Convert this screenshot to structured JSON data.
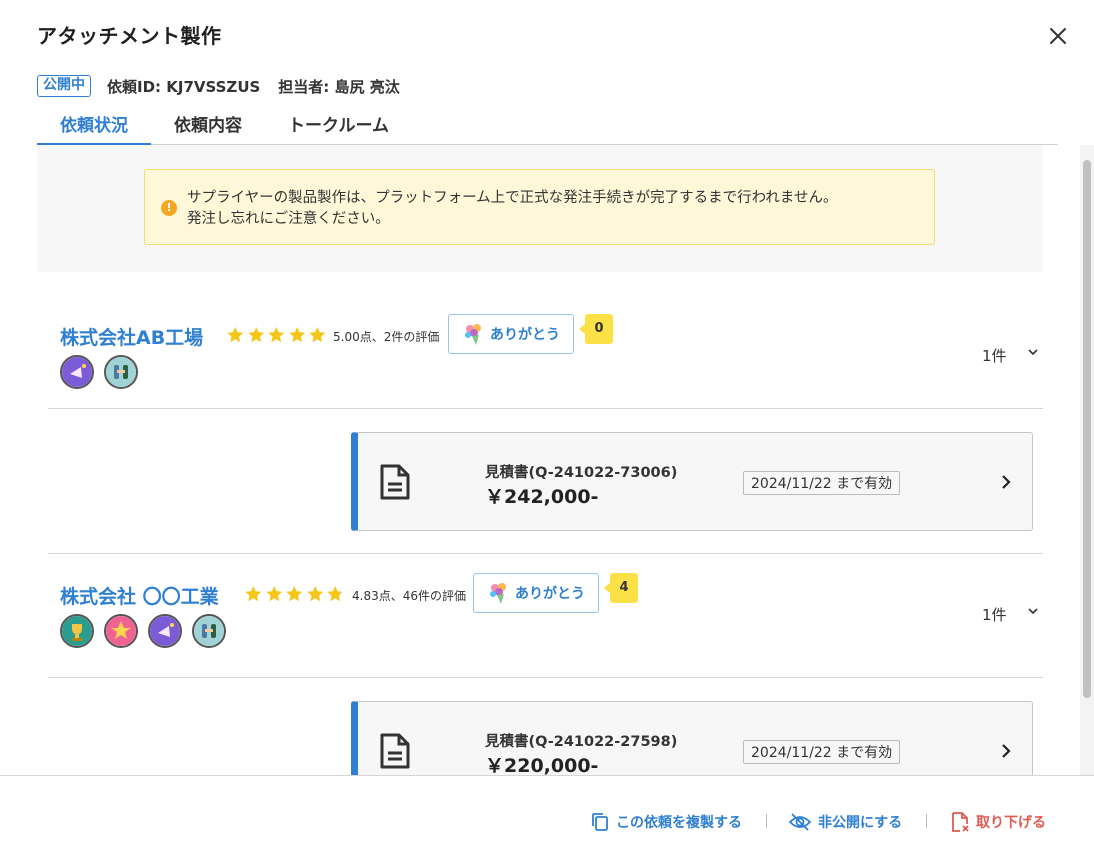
{
  "dialog": {
    "title": "アタッチメント製作"
  },
  "meta": {
    "status_badge": "公開中",
    "request_id": "依頼ID: KJ7VSSZUS",
    "assignee": "担当者: 島尻 亮汰"
  },
  "tabs": [
    {
      "label": "依頼状況",
      "active": true
    },
    {
      "label": "依頼内容",
      "active": false
    },
    {
      "label": "トークルーム",
      "active": false
    }
  ],
  "notice": {
    "line1": "サプライヤーの製品製作は、プラットフォーム上で正式な発注手続きが完了するまで行われません。",
    "line2": "発注し忘れにご注意ください。"
  },
  "suppliers": [
    {
      "name": "株式会社AB工場",
      "rating": 5.0,
      "score_text": "5.00点、2件の評価",
      "thanks_label": "ありがとう",
      "thanks_count": "0",
      "achievement_icons": [
        "megaphone-badge-icon",
        "handshake-badge-icon"
      ],
      "count_label": "1件",
      "quote": {
        "title": "見積書(Q-241022-73006)",
        "price": "￥242,000-",
        "valid": "2024/11/22 まで有効"
      }
    },
    {
      "name": "株式会社 〇〇工業",
      "rating": 4.83,
      "score_text": "4.83点、46件の評価",
      "thanks_label": "ありがとう",
      "thanks_count": "4",
      "achievement_icons": [
        "trophy-badge-icon",
        "star-crown-badge-icon",
        "megaphone-badge-icon",
        "handshake-badge-icon"
      ],
      "count_label": "1件",
      "quote": {
        "title": "見積書(Q-241022-27598)",
        "price": "￥220,000-",
        "valid": "2024/11/22 まで有効"
      }
    }
  ],
  "footer": {
    "duplicate_label": "この依頼を複製する",
    "unpublish_label": "非公開にする",
    "withdraw_label": "取り下げる"
  },
  "colors": {
    "accent": "#2f80d3",
    "star": "#f5c518",
    "notice_bg": "#fef8d9",
    "danger": "#e05a50",
    "bubble": "#fbe046"
  }
}
